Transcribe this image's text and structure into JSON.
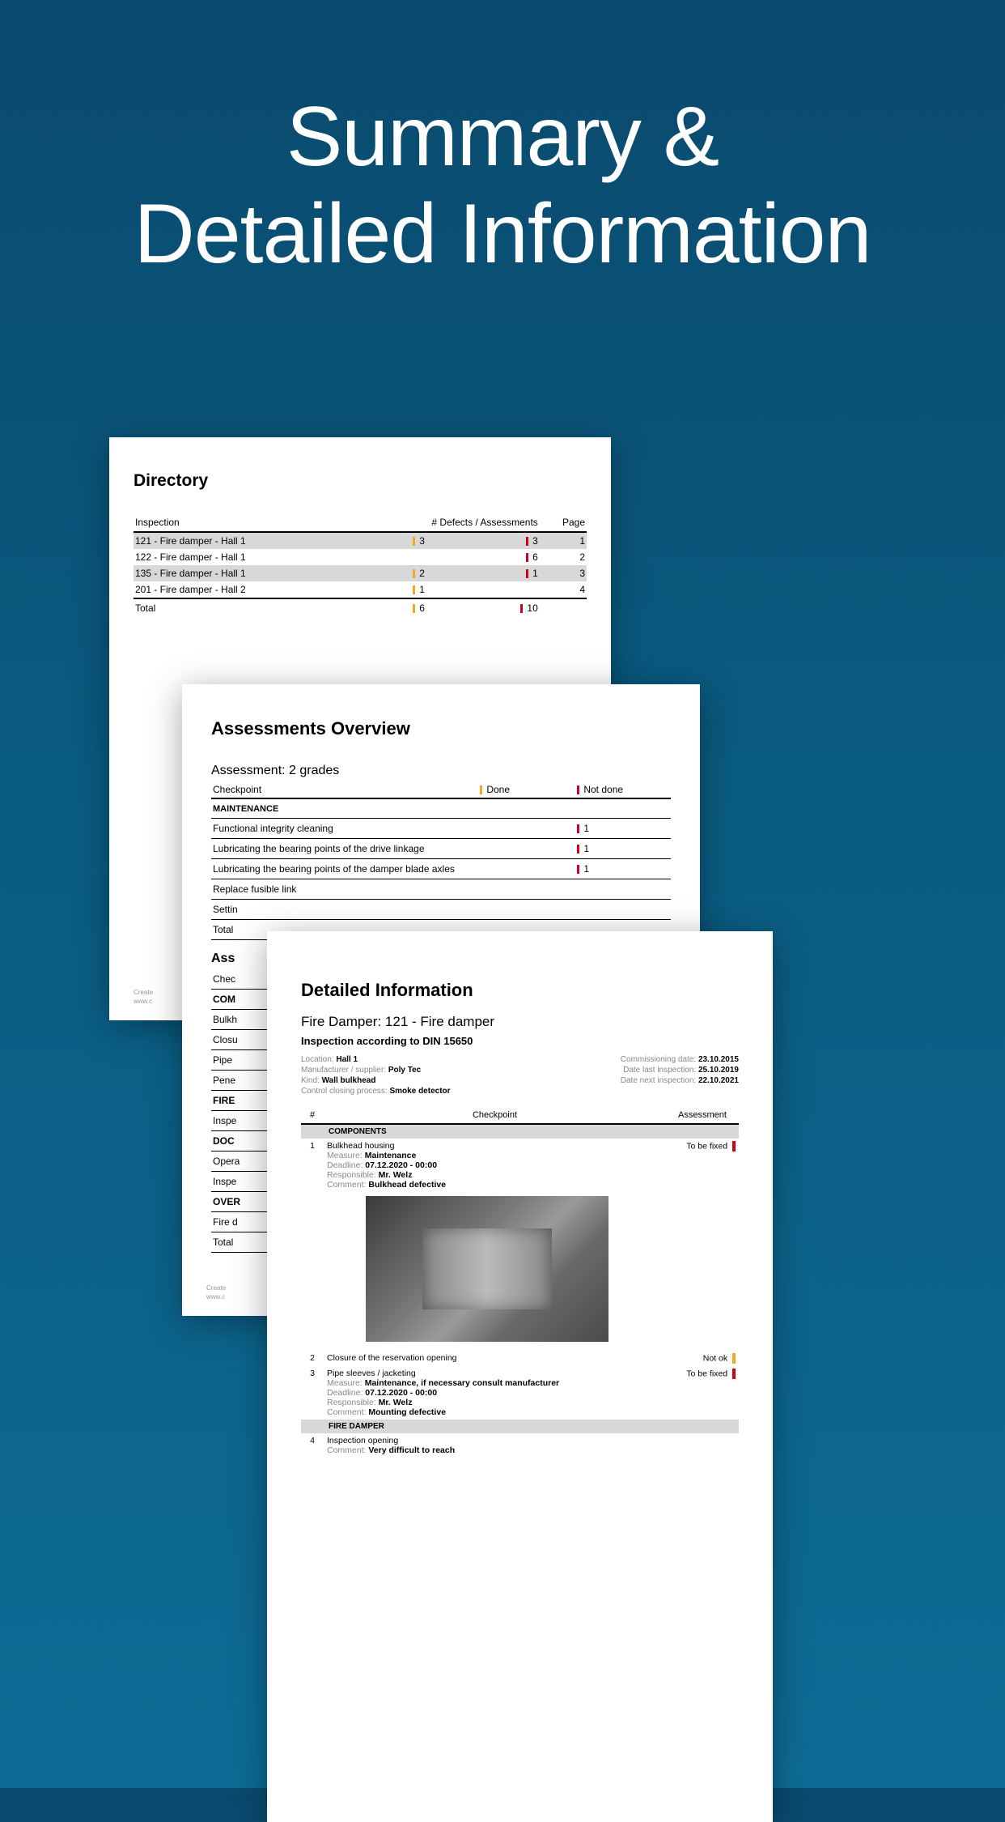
{
  "hero": {
    "line1": "Summary &",
    "line2": "Detailed Information"
  },
  "page1": {
    "title": "Directory",
    "headers": {
      "inspection": "Inspection",
      "defects": "# Defects / Assessments",
      "page": "Page"
    },
    "rows": [
      {
        "name": "121 - Fire damper - Hall 1",
        "defects": "3",
        "assessments": "3",
        "page": "1",
        "alt": true
      },
      {
        "name": "122 - Fire damper - Hall 1",
        "defects": "",
        "assessments": "6",
        "page": "2",
        "alt": false
      },
      {
        "name": "135 - Fire damper - Hall 1",
        "defects": "2",
        "assessments": "1",
        "page": "3",
        "alt": true
      },
      {
        "name": "201 - Fire damper - Hall 2",
        "defects": "1",
        "assessments": "",
        "page": "4",
        "alt": false
      }
    ],
    "total": {
      "label": "Total",
      "defects": "6",
      "assessments": "10"
    },
    "footer1": "Create",
    "footer2": "www.c"
  },
  "page2": {
    "title": "Assessments Overview",
    "subtitle": "Assessment: 2 grades",
    "headers": {
      "checkpoint": "Checkpoint",
      "done": "Done",
      "notdone": "Not done"
    },
    "category": "MAINTENANCE",
    "rows": [
      {
        "name": "Functional integrity cleaning",
        "done": "",
        "notdone": "1"
      },
      {
        "name": "Lubricating the bearing points of the drive linkage",
        "done": "",
        "notdone": "1"
      },
      {
        "name": "Lubricating the bearing points of the damper blade axles",
        "done": "",
        "notdone": "1"
      },
      {
        "name": "Replace fusible link",
        "done": "",
        "notdone": ""
      }
    ],
    "truncated": [
      "Settin",
      "Total"
    ],
    "section2_title": "Ass",
    "truncated2": [
      "Chec",
      "COM",
      "Bulkh",
      "Closu",
      "Pipe",
      "Pene",
      "FIRE",
      "Inspe",
      "DOC",
      "Opera",
      "Inspe",
      "OVER",
      "Fire d",
      "Total"
    ],
    "footer1": "Create",
    "footer2": "www.c"
  },
  "page3": {
    "title": "Detailed Information",
    "subtitle": "Fire Damper: 121 - Fire damper",
    "standard": "Inspection according to DIN 15650",
    "meta_left": [
      {
        "label": "Location:",
        "value": "Hall 1"
      },
      {
        "label": "Manufacturer / supplier:",
        "value": "Poly Tec"
      },
      {
        "label": "Kind:",
        "value": "Wall bulkhead"
      },
      {
        "label": "Control closing process:",
        "value": "Smoke detector"
      }
    ],
    "meta_right": [
      {
        "label": "Commissioning date:",
        "value": "23.10.2015"
      },
      {
        "label": "Date last inspection:",
        "value": "25.10.2019"
      },
      {
        "label": "Date next inspection:",
        "value": "22.10.2021"
      }
    ],
    "headers": {
      "num": "#",
      "checkpoint": "Checkpoint",
      "assessment": "Assessment"
    },
    "sections": [
      {
        "name": "COMPONENTS",
        "items": [
          {
            "num": "1",
            "title": "Bulkhead housing",
            "assessment": "To be fixed",
            "color": "red",
            "details": [
              {
                "label": "Measure:",
                "value": "Maintenance"
              },
              {
                "label": "Deadline:",
                "value": "07.12.2020 - 00:00"
              },
              {
                "label": "Responsible:",
                "value": "Mr. Welz"
              },
              {
                "label": "Comment:",
                "value": "Bulkhead defective"
              }
            ],
            "has_photo": true
          },
          {
            "num": "2",
            "title": "Closure of the reservation opening",
            "assessment": "Not ok",
            "color": "orange"
          },
          {
            "num": "3",
            "title": "Pipe sleeves / jacketing",
            "assessment": "To be fixed",
            "color": "red",
            "details": [
              {
                "label": "Measure:",
                "value": "Maintenance, if necessary consult manufacturer"
              },
              {
                "label": "Deadline:",
                "value": "07.12.2020 - 00:00"
              },
              {
                "label": "Responsible:",
                "value": "Mr. Welz"
              },
              {
                "label": "Comment:",
                "value": "Mounting defective"
              }
            ]
          }
        ]
      },
      {
        "name": "FIRE DAMPER",
        "items": [
          {
            "num": "4",
            "title": "Inspection opening",
            "details": [
              {
                "label": "Comment:",
                "value": "Very difficult to reach"
              }
            ]
          }
        ]
      }
    ]
  }
}
